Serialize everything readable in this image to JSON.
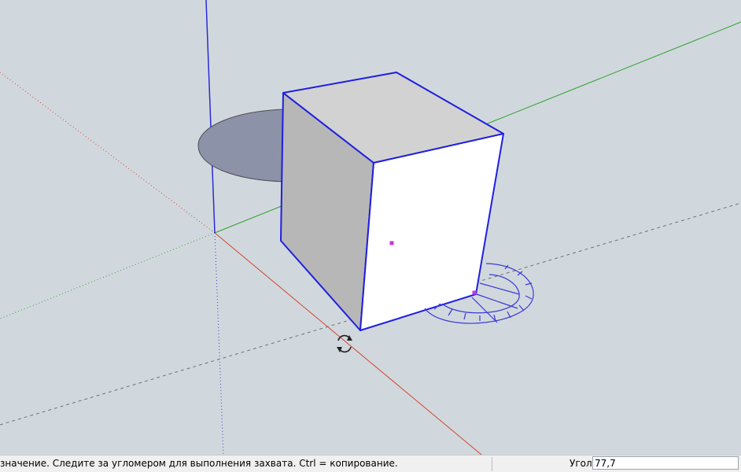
{
  "statusbar": {
    "hint": "значение.  Следите за угломером для выполнения захвата. Ctrl = копирование.",
    "measure_label": "Угол",
    "measure_value": "77,7"
  },
  "viewport": {
    "background": "#d1d8dd",
    "axis_colors": {
      "red": "#d2452e",
      "green": "#2ea02e",
      "blue": "#2b2bd6"
    },
    "selection_color": "#1f1fe0",
    "cursor_icon": "rotate-cursor-icon",
    "protractor_icon": "protractor-icon"
  }
}
